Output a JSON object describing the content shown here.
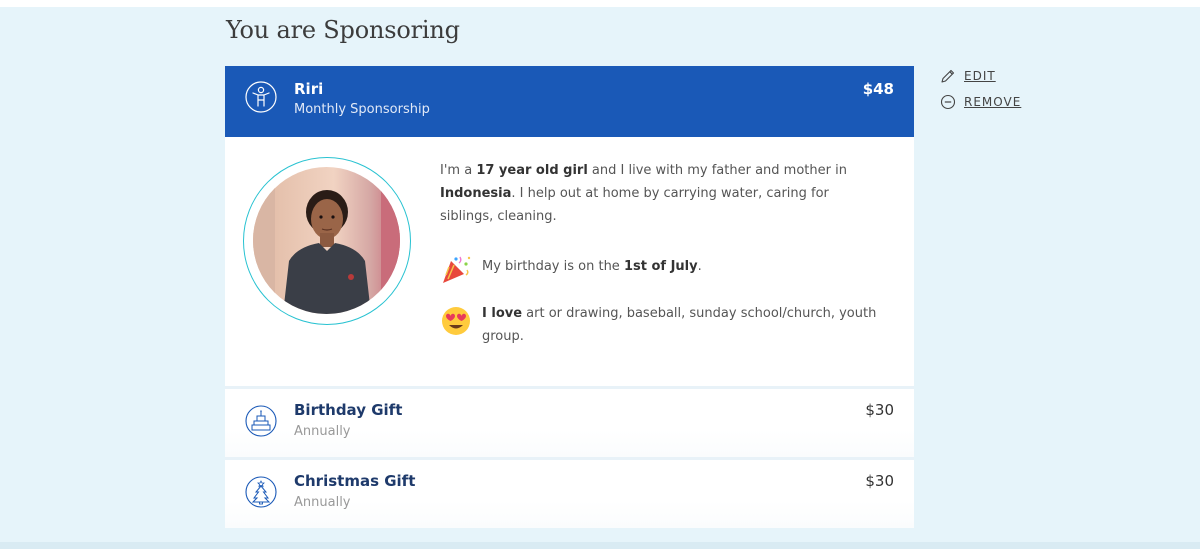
{
  "heading": "You are Sponsoring",
  "sponsorship": {
    "child_name": "Riri",
    "type": "Monthly Sponsorship",
    "price": "$48",
    "accent_color": "#1a59b7",
    "icon": "child-figure-icon"
  },
  "profile": {
    "bio_p1": "I'm a ",
    "bio_age": "17 year old girl",
    "bio_p2": " and I live with my father and mother in ",
    "bio_country": "Indonesia",
    "bio_p3": ". I help out at home by carrying water, caring for siblings, cleaning.",
    "birthday_prefix": "My birthday is on the ",
    "birthday_date": "1st of July",
    "birthday_suffix": ".",
    "love_label": "I love",
    "love_text": " art or drawing, baseball, sunday school/church, youth group."
  },
  "gifts": [
    {
      "name": "Birthday Gift",
      "frequency": "Annually",
      "price": "$30",
      "icon": "birthday-cake-icon"
    },
    {
      "name": "Christmas Gift",
      "frequency": "Annually",
      "price": "$30",
      "icon": "christmas-tree-icon"
    }
  ],
  "actions": {
    "edit_label": "EDIT",
    "remove_label": "REMOVE"
  }
}
